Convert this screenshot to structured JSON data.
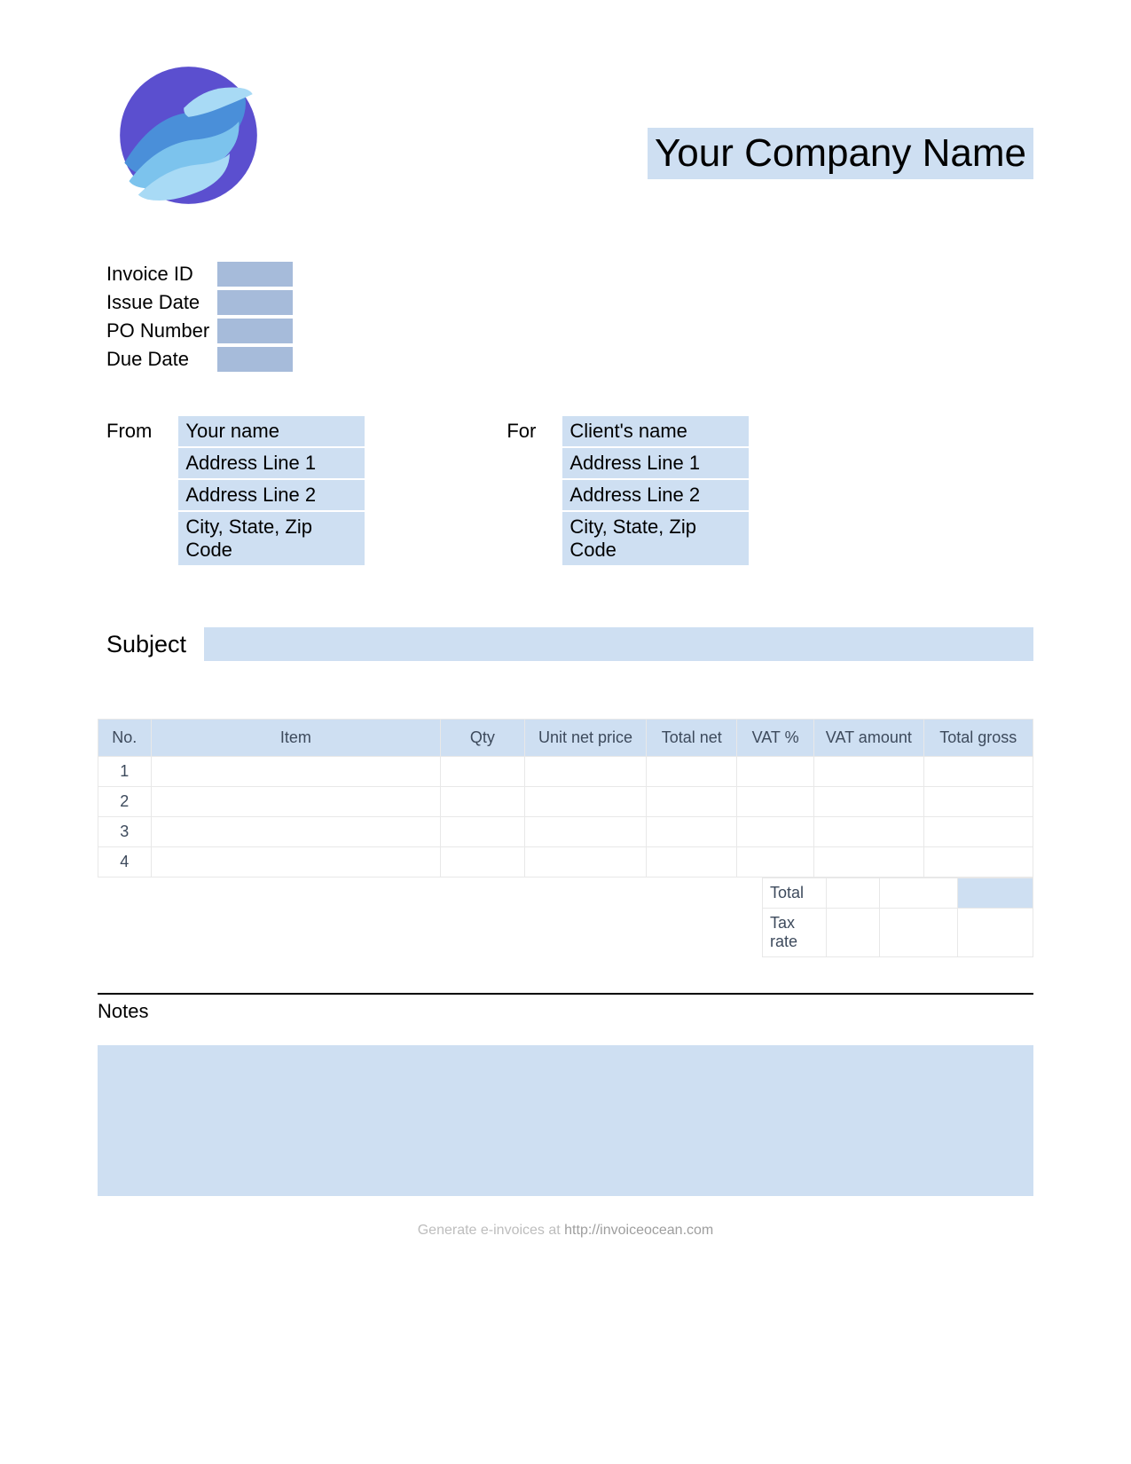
{
  "header": {
    "company_name": "Your Company Name"
  },
  "meta": {
    "invoice_id_label": "Invoice ID",
    "issue_date_label": "Issue Date",
    "po_number_label": "PO Number",
    "due_date_label": "Due Date",
    "invoice_id": "",
    "issue_date": "",
    "po_number": "",
    "due_date": ""
  },
  "from": {
    "label": "From",
    "name": "Your name",
    "address1": "Address Line 1",
    "address2": "Address Line 2",
    "city": "City, State, Zip Code"
  },
  "for": {
    "label": "For",
    "name": "Client's name",
    "address1": "Address Line 1",
    "address2": "Address Line 2",
    "city": "City, State, Zip Code"
  },
  "subject": {
    "label": "Subject",
    "value": ""
  },
  "table": {
    "headers": {
      "no": "No.",
      "item": "Item",
      "qty": "Qty",
      "unit": "Unit net price",
      "totalnet": "Total net",
      "vatp": "VAT %",
      "vatamt": "VAT amount",
      "gross": "Total gross"
    },
    "rows": [
      {
        "no": "1"
      },
      {
        "no": "2"
      },
      {
        "no": "3"
      },
      {
        "no": "4"
      }
    ],
    "totals": {
      "total_label": "Total",
      "taxrate_label": "Tax rate"
    }
  },
  "notes": {
    "label": "Notes",
    "value": ""
  },
  "footer": {
    "text": "Generate e-invoices at ",
    "link": "http://invoiceocean.com"
  }
}
